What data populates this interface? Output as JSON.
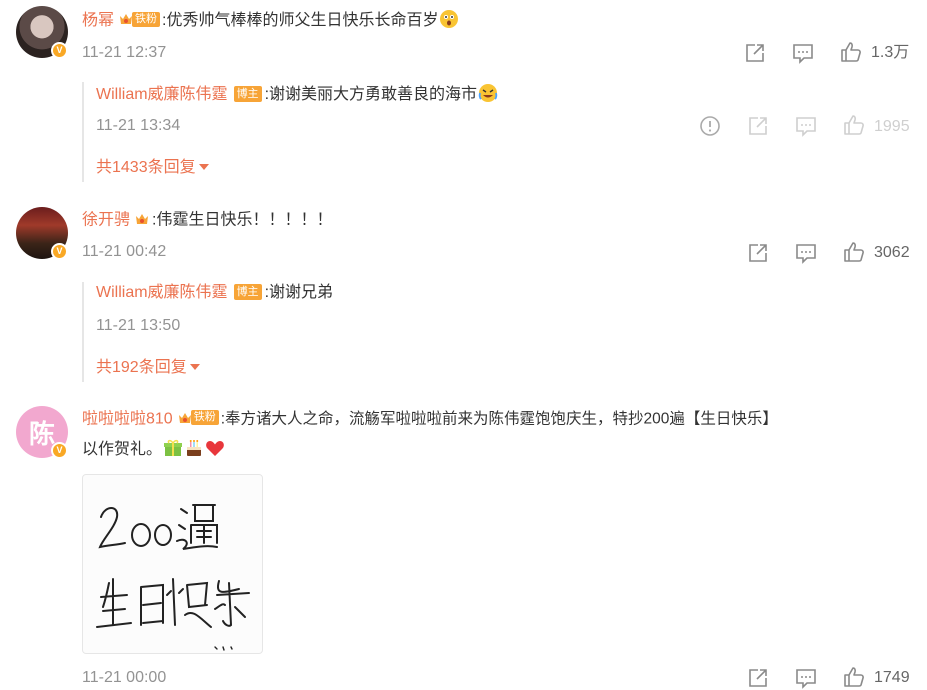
{
  "comments": [
    {
      "user": "杨幂",
      "fan_tag": "铁粉",
      "text": ":优秀帅气棒棒的师父生日快乐长命百岁",
      "time": "11-21 12:37",
      "likes": "1.3万",
      "reply": {
        "user": "William威廉陈伟霆",
        "badge": "博主",
        "text": ":谢谢美丽大方勇敢善良的海市",
        "time": "11-21 13:34",
        "likes": "1995"
      },
      "more_replies": "共1433条回复"
    },
    {
      "user": "徐开骋",
      "text": ":伟霆生日快乐！！！！！",
      "time": "11-21 00:42",
      "likes": "3062",
      "reply": {
        "user": "William威廉陈伟霆",
        "badge": "博主",
        "text": ":谢谢兄弟",
        "time": "11-21 13:50"
      },
      "more_replies": "共192条回复"
    },
    {
      "user": "啦啦啦啦810",
      "fan_tag": "铁粉",
      "avatar_char": "陈",
      "text_line1": ":奉方诸大人之命，流觞军啦啦啦前来为陈伟霆饱饱庆生，特抄200遍【生日快乐】",
      "text_line2": "以作贺礼。",
      "image_caption": "200遍 生日快乐",
      "time": "11-21 00:00",
      "likes": "1749"
    }
  ],
  "colors": {
    "username": "#eb7350",
    "badge": "#f7a437",
    "time": "#939393",
    "icon": "#8a8a8a"
  },
  "icons": [
    "share-icon",
    "comment-icon",
    "like-icon",
    "report-icon",
    "verified-icon",
    "fan-crown-icon"
  ]
}
